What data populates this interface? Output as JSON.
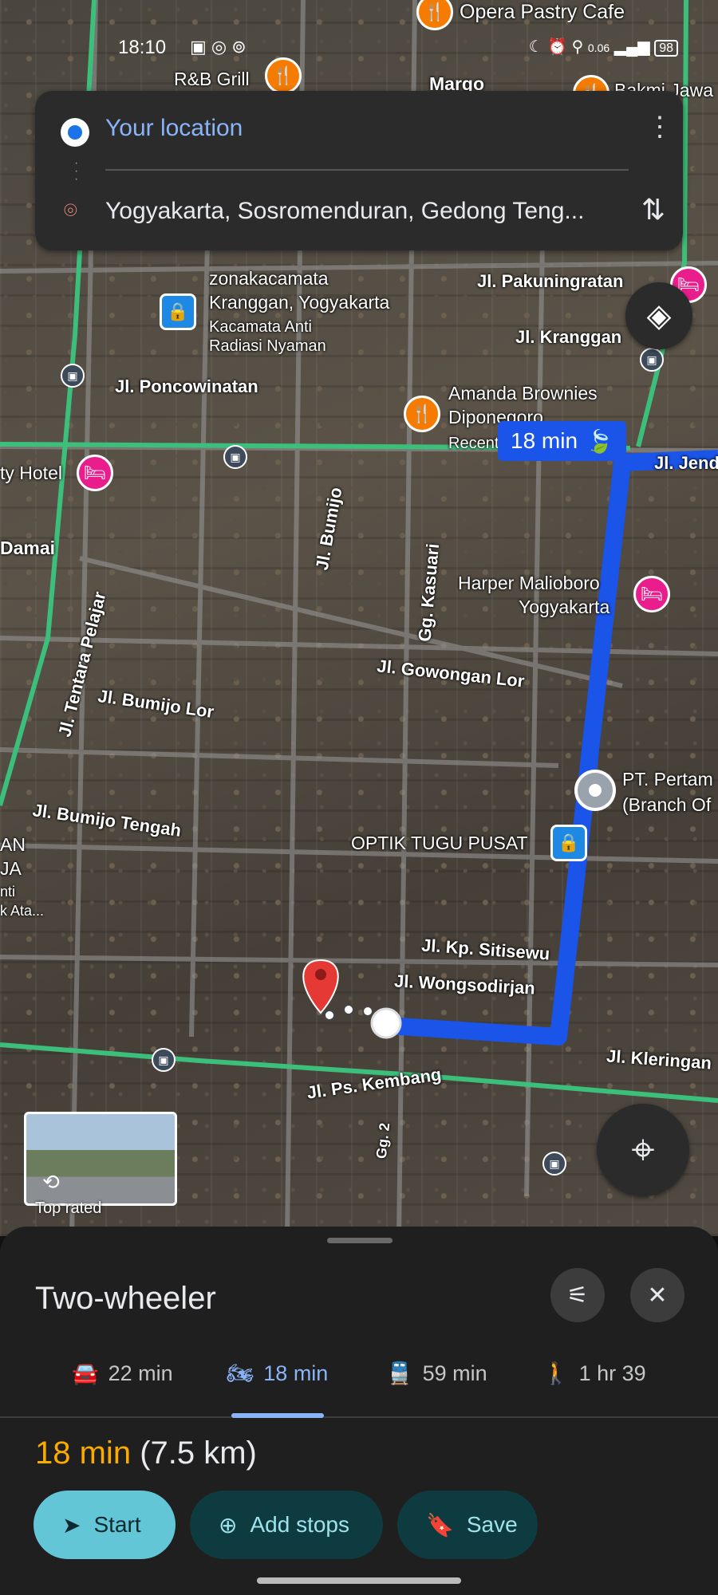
{
  "status": {
    "time": "18:10",
    "speed": "0.06",
    "battery": "98"
  },
  "directions": {
    "origin": "Your location",
    "destination": "Yogyakarta, Sosromenduran, Gedong Teng..."
  },
  "map": {
    "route_time": "18 min",
    "streets": [
      "Jl. Pakuningratan",
      "Jl. Kranggan",
      "Jl. Poncowinatan",
      "Jl. Bumijo",
      "Gg. Kasuari",
      "Jl. Gowongan Lor",
      "Jl. Tentara Pelajar",
      "Jl. Bumijo Lor",
      "Jl. Bumijo Tengah",
      "Jl. Kp. Sitisewu",
      "Jl. Wongsodirjan",
      "Jl. Ps. Kembang",
      "Gg. 2",
      "Jl. Kleringan",
      "Jl. Jenderal"
    ],
    "pois": {
      "opera": "Opera Pastry Cafe",
      "rb_grill": "R&B Grill",
      "margo": "Margo",
      "bakmi": "Bakmi Jawa",
      "zona_1": "zonakacamata",
      "zona_2": "Kranggan, Yogyakarta",
      "zona_3": "Kacamata Anti",
      "zona_4": "Radiasi Nyaman",
      "amanda_1": "Amanda Brownies",
      "amanda_2": "Diponegoro",
      "amanda_3": "Recent",
      "city_hotel": "ty Hotel",
      "damai": "Damai",
      "harper_1": "Harper Malioboro",
      "harper_2": "Yogyakarta",
      "pertamina_1": "PT. Pertam",
      "pertamina_2": "(Branch Of",
      "optik": "OPTIK TUGU PUSAT",
      "left_1": "AN",
      "left_2": "JA",
      "left_3": "nti",
      "left_4": "k Ata..."
    },
    "street_view_label": "Top rated"
  },
  "sheet": {
    "title": "Two-wheeler",
    "modes": [
      {
        "label": "22 min",
        "icon": "car-icon"
      },
      {
        "label": "18 min",
        "icon": "motorcycle-icon"
      },
      {
        "label": "59 min",
        "icon": "train-icon"
      },
      {
        "label": "1 hr 39",
        "icon": "walk-icon"
      }
    ],
    "summary_time": "18 min",
    "summary_distance": "(7.5 km)",
    "buttons": {
      "start": "Start",
      "add_stops": "Add stops",
      "save": "Save"
    }
  },
  "colors": {
    "route": "#1a54e8",
    "accent": "#8ab4f8",
    "start_button": "#62c6d6",
    "summary_time": "#f9ab00"
  }
}
